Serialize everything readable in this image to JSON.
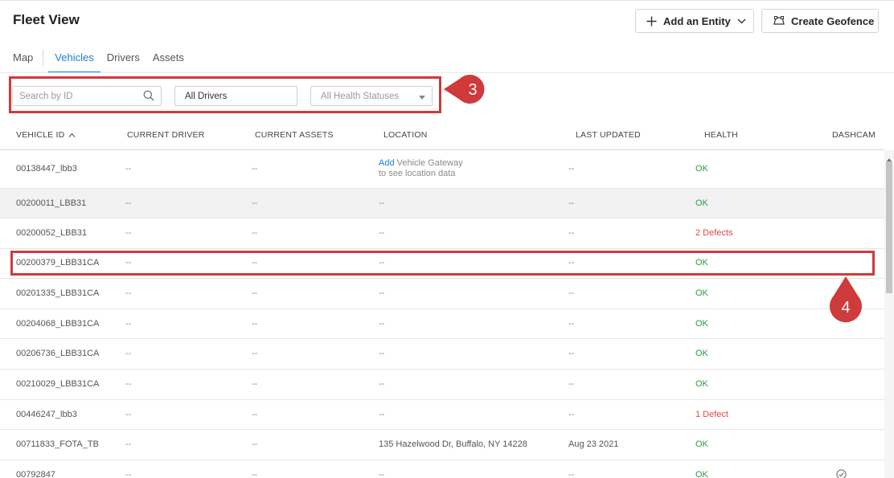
{
  "page": {
    "title": "Fleet View"
  },
  "header": {
    "add_entity_label": "Add an Entity",
    "create_geofence_label": "Create Geofence"
  },
  "tabs": [
    "Map",
    "Vehicles",
    "Drivers",
    "Assets"
  ],
  "active_tab": "Vehicles",
  "filters": {
    "search_placeholder": "Search by ID",
    "drivers_value": "All Drivers",
    "health_placeholder": "All Health Statuses"
  },
  "callouts": {
    "filters": "3",
    "row": "4"
  },
  "table": {
    "columns": [
      "VEHICLE ID",
      "CURRENT DRIVER",
      "CURRENT ASSETS",
      "LOCATION",
      "LAST UPDATED",
      "HEALTH",
      "DASHCAM"
    ],
    "sort_column": "VEHICLE ID",
    "rows": [
      {
        "id": "00138447_lbb3",
        "driver": "--",
        "assets": "--",
        "location_link": "Add",
        "location_text": "Vehicle Gateway",
        "location_line2": "to see location data",
        "updated": "--",
        "health": "OK",
        "dashcam": ""
      },
      {
        "id": "00200011_LBB31",
        "driver": "--",
        "assets": "--",
        "location": "--",
        "updated": "--",
        "health": "OK",
        "dashcam": ""
      },
      {
        "id": "00200052_LBB31",
        "driver": "--",
        "assets": "--",
        "location": "--",
        "updated": "--",
        "health": "2 Defects",
        "dashcam": ""
      },
      {
        "id": "00200379_LBB31CA",
        "driver": "--",
        "assets": "--",
        "location": "--",
        "updated": "--",
        "health": "OK",
        "dashcam": ""
      },
      {
        "id": "00201335_LBB31CA",
        "driver": "--",
        "assets": "--",
        "location": "--",
        "updated": "--",
        "health": "OK",
        "dashcam": ""
      },
      {
        "id": "00204068_LBB31CA",
        "driver": "--",
        "assets": "--",
        "location": "--",
        "updated": "--",
        "health": "OK",
        "dashcam": ""
      },
      {
        "id": "00206736_LBB31CA",
        "driver": "--",
        "assets": "--",
        "location": "--",
        "updated": "--",
        "health": "OK",
        "dashcam": ""
      },
      {
        "id": "00210029_LBB31CA",
        "driver": "--",
        "assets": "--",
        "location": "--",
        "updated": "--",
        "health": "OK",
        "dashcam": ""
      },
      {
        "id": "00446247_lbb3",
        "driver": "--",
        "assets": "--",
        "location": "--",
        "updated": "--",
        "health": "1 Defect",
        "dashcam": ""
      },
      {
        "id": "00711833_FOTA_TB",
        "driver": "--",
        "assets": "--",
        "location": "135 Hazelwood Dr, Buffalo, NY 14228",
        "updated": "Aug 23 2021",
        "health": "OK",
        "dashcam": ""
      },
      {
        "id": "00792847",
        "driver": "--",
        "assets": "--",
        "location": "--",
        "updated": "--",
        "health": "OK",
        "dashcam": "check-circle-icon"
      }
    ]
  },
  "colors": {
    "accent": "#1a7fd6",
    "ok": "#2e9a3e",
    "defect": "#e04848",
    "callout": "#cf3a3a"
  }
}
